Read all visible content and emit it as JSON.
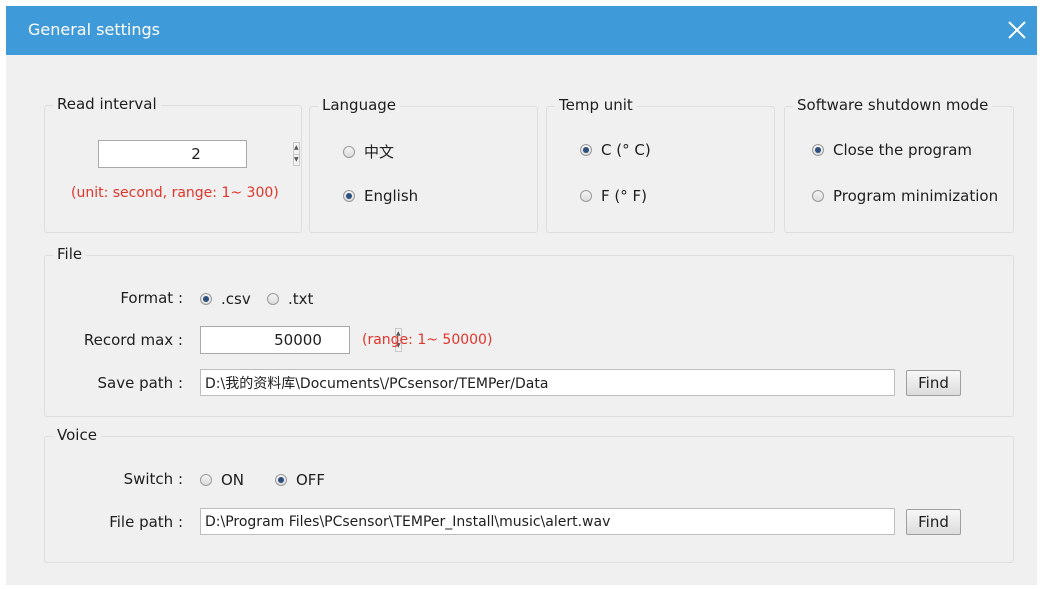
{
  "window": {
    "title": "General settings"
  },
  "read_interval": {
    "legend": "Read interval",
    "value": "2",
    "hint": "(unit: second, range: 1~ 300)"
  },
  "language": {
    "legend": "Language",
    "options": [
      "中文",
      "English"
    ],
    "selected": "English"
  },
  "temp_unit": {
    "legend": "Temp unit",
    "options": [
      "C (° C)",
      "F (° F)"
    ],
    "selected": "C (° C)"
  },
  "shutdown_mode": {
    "legend": "Software shutdown mode",
    "options": [
      "Close the program",
      "Program minimization"
    ],
    "selected": "Close the program"
  },
  "file": {
    "legend": "File",
    "format_label": "Format :",
    "format_options": [
      ".csv",
      ".txt"
    ],
    "format_selected": ".csv",
    "record_max_label": "Record max :",
    "record_max_value": "50000",
    "record_max_hint": "(range: 1~ 50000)",
    "save_path_label": "Save path :",
    "save_path_value": "D:\\我的资料库\\Documents\\/PCsensor/TEMPer/Data",
    "find_label": "Find"
  },
  "voice": {
    "legend": "Voice",
    "switch_label": "Switch :",
    "switch_options": [
      "ON",
      "OFF"
    ],
    "switch_selected": "OFF",
    "file_path_label": "File path :",
    "file_path_value": "D:\\Program Files\\PCsensor\\TEMPer_Install\\music\\alert.wav",
    "find_label": "Find"
  },
  "colors": {
    "titlebar": "#3f9ad9",
    "window_bg": "#f0f0f0",
    "hint_red": "#e0352b"
  }
}
